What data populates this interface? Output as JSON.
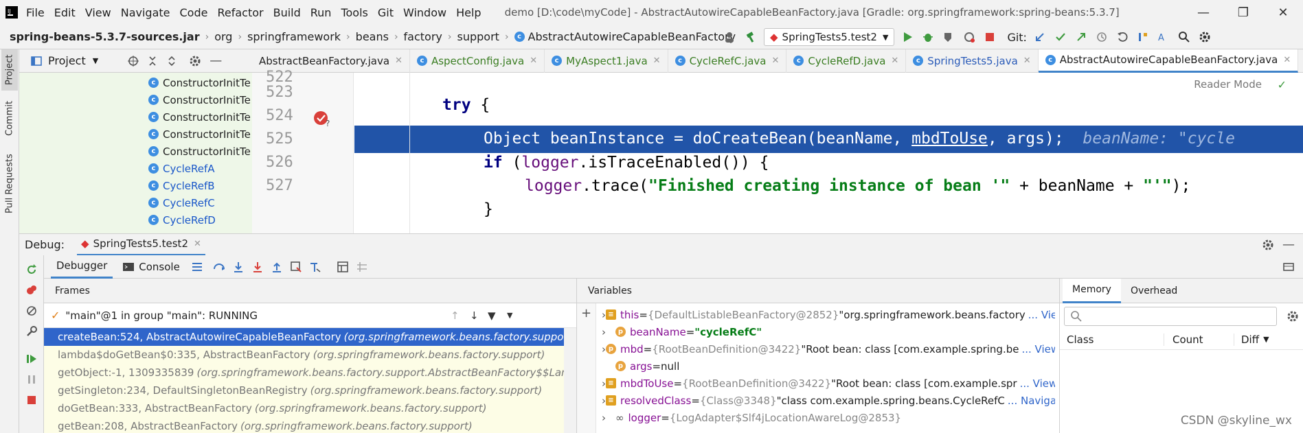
{
  "menubar": {
    "items": [
      "File",
      "Edit",
      "View",
      "Navigate",
      "Code",
      "Refactor",
      "Build",
      "Run",
      "Tools",
      "Git",
      "Window",
      "Help"
    ],
    "window_title": "demo [D:\\code\\myCode] - AbstractAutowireCapableBeanFactory.java [Gradle: org.springframework:spring-beans:5.3.7]"
  },
  "navbar": {
    "crumbs": [
      "spring-beans-5.3.7-sources.jar",
      "org",
      "springframework",
      "beans",
      "factory",
      "support",
      "AbstractAutowireCapableBeanFactory"
    ],
    "run_config": "SpringTests5.test2",
    "git_label": "Git:"
  },
  "left_strip": {
    "project_tab": "Project",
    "commit_tab": "Commit",
    "pull_requests_tab": "Pull Requests"
  },
  "project": {
    "title": "Project",
    "items": [
      {
        "label": "ConstructorInitTe",
        "blue": false
      },
      {
        "label": "ConstructorInitTe",
        "blue": false
      },
      {
        "label": "ConstructorInitTe",
        "blue": false
      },
      {
        "label": "ConstructorInitTe",
        "blue": false
      },
      {
        "label": "ConstructorInitTe",
        "blue": false
      },
      {
        "label": "CycleRefA",
        "blue": true
      },
      {
        "label": "CycleRefB",
        "blue": true
      },
      {
        "label": "CycleRefC",
        "blue": true
      },
      {
        "label": "CycleRefD",
        "blue": true
      }
    ]
  },
  "tabs": [
    {
      "label": "AbstractBeanFactory.java",
      "style": "plain"
    },
    {
      "label": "AspectConfig.java",
      "style": "green"
    },
    {
      "label": "MyAspect1.java",
      "style": "green"
    },
    {
      "label": "CycleRefC.java",
      "style": "green"
    },
    {
      "label": "CycleRefD.java",
      "style": "green"
    },
    {
      "label": "SpringTests5.java",
      "style": "blue"
    },
    {
      "label": "AbstractAutowireCapableBeanFactory.java",
      "style": "active"
    }
  ],
  "editor": {
    "reader_mode": "Reader Mode",
    "line_numbers": [
      "522",
      "523",
      "524",
      "525",
      "526",
      "527"
    ],
    "inlay_hint": "beanName: \"cycle"
  },
  "debug": {
    "label": "Debug:",
    "session": "SpringTests5.test2",
    "debugger_tab": "Debugger",
    "console_tab": "Console",
    "frames_title": "Frames",
    "thread": "\"main\"@1 in group \"main\": RUNNING",
    "frames": [
      {
        "method": "createBean:524, AbstractAutowireCapableBeanFactory",
        "pkg": "(org.springframework.beans.factory.support)"
      },
      {
        "method": "lambda$doGetBean$0:335, AbstractBeanFactory",
        "pkg": "(org.springframework.beans.factory.support)"
      },
      {
        "method": "getObject:-1, 1309335839",
        "pkg": "(org.springframework.beans.factory.support.AbstractBeanFactory$$Lambda$"
      },
      {
        "method": "getSingleton:234, DefaultSingletonBeanRegistry",
        "pkg": "(org.springframework.beans.factory.support)"
      },
      {
        "method": "doGetBean:333, AbstractBeanFactory",
        "pkg": "(org.springframework.beans.factory.support)"
      },
      {
        "method": "getBean:208, AbstractBeanFactory",
        "pkg": "(org.springframework.beans.factory.support)"
      }
    ],
    "variables_title": "Variables",
    "variables": [
      {
        "name": "this",
        "eq": " = ",
        "type": "{DefaultListableBeanFactory@2852}",
        "value": " \"org.springframework.beans.factory",
        "link": "... View",
        "badge": ""
      },
      {
        "name": "beanName",
        "eq": " = ",
        "type": "",
        "value": "\"cycleRefC\"",
        "link": "",
        "badge": "p"
      },
      {
        "name": "mbd",
        "eq": " = ",
        "type": "{RootBeanDefinition@3422}",
        "value": " \"Root bean: class [com.example.spring.be",
        "link": "... View",
        "badge": "p"
      },
      {
        "name": "args",
        "eq": " = ",
        "type": "",
        "value": "null",
        "link": "",
        "badge": "p"
      },
      {
        "name": "mbdToUse",
        "eq": " = ",
        "type": "{RootBeanDefinition@3422}",
        "value": " \"Root bean: class [com.example.spr",
        "link": "... View",
        "badge": ""
      },
      {
        "name": "resolvedClass",
        "eq": " = ",
        "type": "{Class@3348}",
        "value": " \"class com.example.spring.beans.CycleRefC",
        "link": "... Navigate",
        "badge": ""
      },
      {
        "name": "logger",
        "eq": " = ",
        "type": "{LogAdapter$Slf4jLocationAwareLog@2853}",
        "value": "",
        "link": "",
        "badge": ""
      }
    ],
    "memory_tab": "Memory",
    "overhead_tab": "Overhead",
    "memory_cols": [
      "Class",
      "Count",
      "Diff"
    ]
  },
  "watermark": "CSDN @skyline_wx"
}
